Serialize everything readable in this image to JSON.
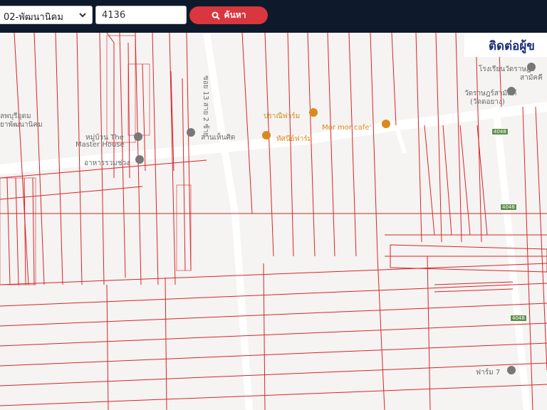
{
  "search": {
    "district_value": "02-พัฒนานิคม",
    "parcel_value": "4136",
    "button_label": "ค้นหา"
  },
  "contact": {
    "label": "ติดต่อผู้ข"
  },
  "map": {
    "pois": [
      {
        "label": "โรงเรียนวัดราษฎร์",
        "icon": "pin-gray"
      },
      {
        "label": "สามัคคี",
        "icon": "none"
      },
      {
        "label": "วัดราษฎร์สามัคคี",
        "icon": "temple-gray"
      },
      {
        "label": "(วัดดอยาง)",
        "icon": "none"
      },
      {
        "label": "ปราณีฟาร์ม",
        "icon": "pin-orange"
      },
      {
        "label": "ทัศนีย์ฟาร์ม",
        "icon": "pin-orange"
      },
      {
        "label": "Mor mor cafe'",
        "icon": "cafe-orange"
      },
      {
        "label": "หมู่บ้าน The",
        "icon": "pin-gray"
      },
      {
        "label": "Master House",
        "icon": "none"
      },
      {
        "label": "ลานเห็นศิต",
        "icon": "pin-gray"
      },
      {
        "label": "อาหารรวมช่วง",
        "icon": "pin-gray"
      },
      {
        "label": "ซอย 13 สาย 2 ซ้าย",
        "icon": "none"
      },
      {
        "label": "ฟาร์ม 7",
        "icon": "pin-gray"
      },
      {
        "label": "ลพบุรีอุดม",
        "icon": "none"
      },
      {
        "label": "ยาพัฒนานิคม",
        "icon": "none"
      }
    ],
    "road_numbers": [
      "4048",
      "4048",
      "4048"
    ]
  },
  "colors": {
    "topbar": "#0e1a2b",
    "button": "#d9363e",
    "parcel_line": "#d9232a",
    "poi_orange": "#d98a1a"
  }
}
